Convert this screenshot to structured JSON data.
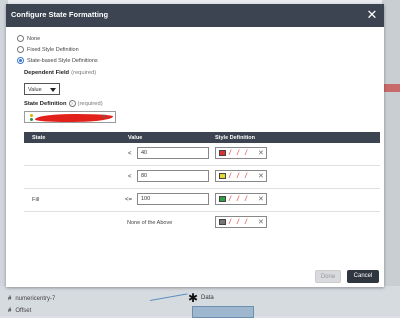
{
  "background": {
    "row1": {
      "hash": "#",
      "label": "numericentry-7"
    },
    "row2": {
      "hash": "#",
      "label": "Offset"
    },
    "node_label": "Data"
  },
  "modal": {
    "title": "Configure State Formatting",
    "close_icon": "close-icon",
    "options": [
      {
        "label": "None",
        "checked": false
      },
      {
        "label": "Fixed Style Definition",
        "checked": false
      },
      {
        "label": "State-based Style Definitions",
        "checked": true
      }
    ],
    "dependent_field": {
      "label": "Dependent Field",
      "required": "(required)",
      "value": "Value"
    },
    "state_definition": {
      "label": "State Definition",
      "required": "(required)"
    },
    "table": {
      "headers": {
        "state": "State",
        "value": "Value",
        "style": "Style Definition"
      },
      "rows": [
        {
          "state": "",
          "op": "<",
          "value": "40",
          "color": "#d9322e"
        },
        {
          "state": "",
          "op": "<",
          "value": "80",
          "color": "#e8d82c"
        },
        {
          "state": "Fill",
          "op": "<=",
          "value": "100",
          "color": "#2ea043"
        },
        {
          "state": "",
          "op": "",
          "value": "None of the Above",
          "color": "#777777"
        }
      ]
    },
    "buttons": {
      "done": "Done",
      "cancel": "Cancel"
    }
  },
  "colors": {
    "header_bg": "#3b4450",
    "accent": "#3a77c8",
    "redaction": "#e3211b"
  }
}
